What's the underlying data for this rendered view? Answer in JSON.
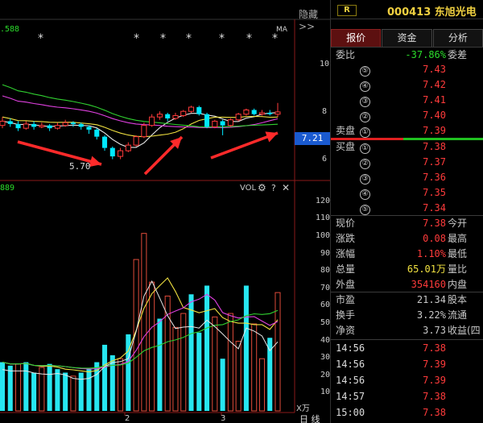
{
  "chart_header": {
    "hide_label": "隐藏>>",
    "price_top_left": ".588",
    "ma_label": "MA",
    "vol_left": "889",
    "vol_label": "VOL",
    "low_marker": "5.70",
    "current_price_tag": "7.21",
    "vol_unit": "X万",
    "period_label": "日 线"
  },
  "price_axis": [
    "10",
    "8",
    "6"
  ],
  "vol_axis": [
    "120",
    "110",
    "100",
    "90",
    "80",
    "70",
    "60",
    "50",
    "40",
    "30",
    "20",
    "10"
  ],
  "x_axis": [
    "2",
    "3"
  ],
  "stock": {
    "tag": "R",
    "code": "000413 东旭光电"
  },
  "tabs": [
    "报价",
    "资金",
    "分析"
  ],
  "weibi": {
    "label": "委比",
    "value": "-37.86%",
    "tail": "委差"
  },
  "sells": [
    {
      "label": "",
      "num": "⑤",
      "price": "7.43"
    },
    {
      "label": "",
      "num": "④",
      "price": "7.42"
    },
    {
      "label": "",
      "num": "③",
      "price": "7.41"
    },
    {
      "label": "",
      "num": "②",
      "price": "7.40"
    },
    {
      "label": "卖盘",
      "num": "①",
      "price": "7.39"
    }
  ],
  "buys": [
    {
      "label": "买盘",
      "num": "①",
      "price": "7.38"
    },
    {
      "label": "",
      "num": "②",
      "price": "7.37"
    },
    {
      "label": "",
      "num": "③",
      "price": "7.36"
    },
    {
      "label": "",
      "num": "④",
      "price": "7.35"
    },
    {
      "label": "",
      "num": "⑤",
      "price": "7.34"
    }
  ],
  "quotes": [
    {
      "label": "现价",
      "value": "7.38",
      "tail": "今开"
    },
    {
      "label": "涨跌",
      "value": "0.08",
      "tail": "最高"
    },
    {
      "label": "涨幅",
      "value": "1.10%",
      "tail": "最低"
    },
    {
      "label": "总量",
      "value": "65.01万",
      "tail": "量比"
    },
    {
      "label": "外盘",
      "value": "354160",
      "tail": "内盘"
    }
  ],
  "stats": [
    {
      "label": "市盈",
      "value": "21.34",
      "tail": "股本"
    },
    {
      "label": "换手",
      "value": "3.22%",
      "tail": "流通"
    },
    {
      "label": "净资",
      "value": "3.73",
      "tail": "收益(四"
    }
  ],
  "ticks": [
    {
      "time": "14:56",
      "price": "7.38"
    },
    {
      "time": "14:56",
      "price": "7.39"
    },
    {
      "time": "14:56",
      "price": "7.39"
    },
    {
      "time": "14:57",
      "price": "7.38"
    },
    {
      "time": "15:00",
      "price": "7.38"
    }
  ],
  "colors": {
    "up": "#ff3b3b",
    "down": "#00e8ff",
    "bar_up": "#e04b3a",
    "bar_down": "#27e6f0"
  },
  "chart_data": {
    "type": "bar",
    "title": "",
    "ylim_price": [
      5.0,
      10.5
    ],
    "ylim_vol": [
      0,
      125
    ],
    "price_candles": [
      {
        "o": 6.9,
        "c": 7.05,
        "h": 7.2,
        "l": 6.8
      },
      {
        "o": 7.05,
        "c": 6.95,
        "h": 7.15,
        "l": 6.85
      },
      {
        "o": 6.95,
        "c": 6.8,
        "h": 7.05,
        "l": 6.7
      },
      {
        "o": 6.8,
        "c": 6.95,
        "h": 7.05,
        "l": 6.75
      },
      {
        "o": 6.95,
        "c": 6.85,
        "h": 7.05,
        "l": 6.75
      },
      {
        "o": 6.85,
        "c": 6.9,
        "h": 7.0,
        "l": 6.8
      },
      {
        "o": 6.9,
        "c": 6.8,
        "h": 6.95,
        "l": 6.7
      },
      {
        "o": 6.8,
        "c": 6.9,
        "h": 7.0,
        "l": 6.75
      },
      {
        "o": 6.9,
        "c": 7.0,
        "h": 7.1,
        "l": 6.85
      },
      {
        "o": 7.0,
        "c": 6.95,
        "h": 7.05,
        "l": 6.85
      },
      {
        "o": 6.95,
        "c": 6.85,
        "h": 7.0,
        "l": 6.75
      },
      {
        "o": 6.85,
        "c": 6.75,
        "h": 6.9,
        "l": 6.6
      },
      {
        "o": 6.75,
        "c": 6.5,
        "h": 6.8,
        "l": 6.4
      },
      {
        "o": 6.5,
        "c": 6.1,
        "h": 6.55,
        "l": 6.0
      },
      {
        "o": 6.1,
        "c": 5.8,
        "h": 6.15,
        "l": 5.7
      },
      {
        "o": 5.8,
        "c": 6.0,
        "h": 6.1,
        "l": 5.7
      },
      {
        "o": 6.0,
        "c": 6.2,
        "h": 6.3,
        "l": 5.95
      },
      {
        "o": 6.2,
        "c": 6.5,
        "h": 6.55,
        "l": 6.15
      },
      {
        "o": 6.5,
        "c": 6.9,
        "h": 7.0,
        "l": 6.45
      },
      {
        "o": 6.9,
        "c": 7.2,
        "h": 7.3,
        "l": 6.85
      },
      {
        "o": 7.2,
        "c": 7.3,
        "h": 7.4,
        "l": 7.1
      },
      {
        "o": 7.3,
        "c": 7.15,
        "h": 7.35,
        "l": 7.05
      },
      {
        "o": 7.15,
        "c": 7.25,
        "h": 7.35,
        "l": 7.1
      },
      {
        "o": 7.25,
        "c": 7.4,
        "h": 7.45,
        "l": 7.2
      },
      {
        "o": 7.4,
        "c": 7.55,
        "h": 7.6,
        "l": 7.35
      },
      {
        "o": 7.55,
        "c": 7.3,
        "h": 7.6,
        "l": 7.25
      },
      {
        "o": 7.3,
        "c": 6.85,
        "h": 7.35,
        "l": 6.8
      },
      {
        "o": 6.85,
        "c": 7.05,
        "h": 7.1,
        "l": 6.8
      },
      {
        "o": 7.05,
        "c": 6.9,
        "h": 7.1,
        "l": 6.55
      },
      {
        "o": 6.9,
        "c": 7.1,
        "h": 7.15,
        "l": 6.85
      },
      {
        "o": 7.1,
        "c": 7.3,
        "h": 7.35,
        "l": 7.05
      },
      {
        "o": 7.3,
        "c": 7.45,
        "h": 7.5,
        "l": 7.25
      },
      {
        "o": 7.45,
        "c": 7.3,
        "h": 7.5,
        "l": 7.25
      },
      {
        "o": 7.3,
        "c": 7.35,
        "h": 7.45,
        "l": 7.25
      },
      {
        "o": 7.35,
        "c": 7.3,
        "h": 7.45,
        "l": 7.25
      },
      {
        "o": 7.3,
        "c": 7.38,
        "h": 7.7,
        "l": 7.2
      }
    ],
    "volumes": [
      {
        "v": 28,
        "up": false
      },
      {
        "v": 26,
        "up": false
      },
      {
        "v": 27,
        "up": true
      },
      {
        "v": 28,
        "up": false
      },
      {
        "v": 22,
        "up": false
      },
      {
        "v": 25,
        "up": true
      },
      {
        "v": 27,
        "up": false
      },
      {
        "v": 24,
        "up": false
      },
      {
        "v": 22,
        "up": false
      },
      {
        "v": 20,
        "up": true
      },
      {
        "v": 22,
        "up": false
      },
      {
        "v": 24,
        "up": false
      },
      {
        "v": 28,
        "up": false
      },
      {
        "v": 38,
        "up": false
      },
      {
        "v": 32,
        "up": false
      },
      {
        "v": 30,
        "up": true
      },
      {
        "v": 44,
        "up": false
      },
      {
        "v": 87,
        "up": true
      },
      {
        "v": 102,
        "up": true
      },
      {
        "v": 74,
        "up": true
      },
      {
        "v": 53,
        "up": false
      },
      {
        "v": 66,
        "up": true
      },
      {
        "v": 48,
        "up": true
      },
      {
        "v": 56,
        "up": true
      },
      {
        "v": 67,
        "up": false
      },
      {
        "v": 45,
        "up": false
      },
      {
        "v": 72,
        "up": false
      },
      {
        "v": 54,
        "up": true
      },
      {
        "v": 30,
        "up": false
      },
      {
        "v": 56,
        "up": true
      },
      {
        "v": 40,
        "up": true
      },
      {
        "v": 72,
        "up": false
      },
      {
        "v": 50,
        "up": true
      },
      {
        "v": 30,
        "up": true
      },
      {
        "v": 42,
        "up": false
      },
      {
        "v": 68,
        "up": true
      }
    ]
  }
}
